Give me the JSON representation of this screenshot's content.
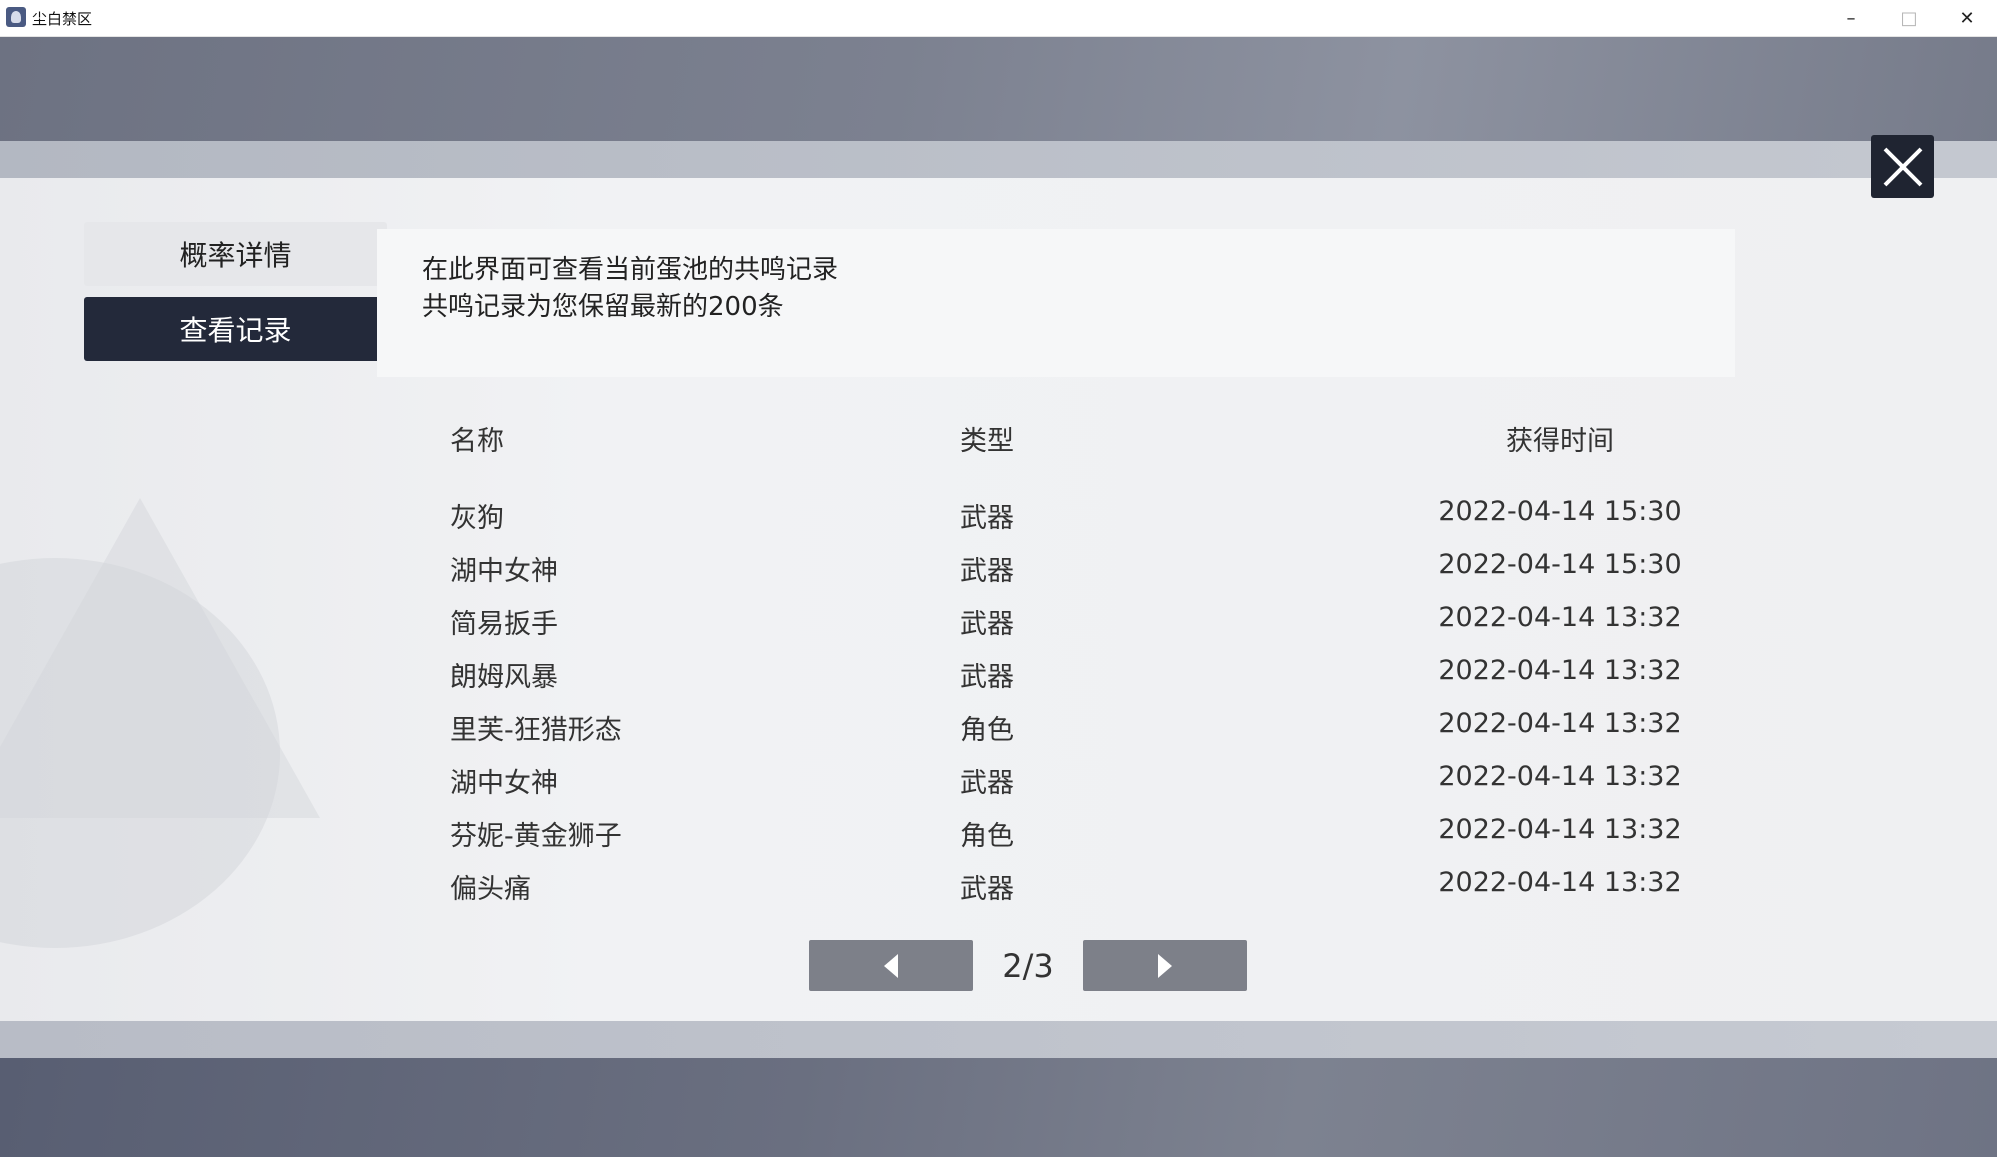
{
  "window": {
    "title": "尘白禁区",
    "controls": {
      "minimize": "–",
      "maximize": "□",
      "close": "✕"
    }
  },
  "tabs": [
    {
      "label": "概率详情",
      "active": false
    },
    {
      "label": "查看记录",
      "active": true
    }
  ],
  "notice": {
    "line1": "在此界面可查看当前蛋池的共鸣记录",
    "line2": "共鸣记录为您保留最新的200条"
  },
  "table": {
    "headers": {
      "name": "名称",
      "type": "类型",
      "time": "获得时间"
    },
    "rows": [
      {
        "name": "灰狗",
        "type": "武器",
        "time": "2022-04-14 15:30"
      },
      {
        "name": "湖中女神",
        "type": "武器",
        "time": "2022-04-14 15:30"
      },
      {
        "name": "简易扳手",
        "type": "武器",
        "time": "2022-04-14 13:32"
      },
      {
        "name": "朗姆风暴",
        "type": "武器",
        "time": "2022-04-14 13:32"
      },
      {
        "name": "里芙-狂猎形态",
        "type": "角色",
        "time": "2022-04-14 13:32"
      },
      {
        "name": "湖中女神",
        "type": "武器",
        "time": "2022-04-14 13:32"
      },
      {
        "name": "芬妮-黄金狮子",
        "type": "角色",
        "time": "2022-04-14 13:32"
      },
      {
        "name": "偏头痛",
        "type": "武器",
        "time": "2022-04-14 13:32"
      }
    ]
  },
  "pagination": {
    "current": 2,
    "total": 3,
    "label": "2/3"
  },
  "icons": {
    "close": "close-icon",
    "prev": "arrow-left-icon",
    "next": "arrow-right-icon"
  },
  "colors": {
    "accent_dark": "#23293a",
    "page_button": "#7d8089"
  }
}
